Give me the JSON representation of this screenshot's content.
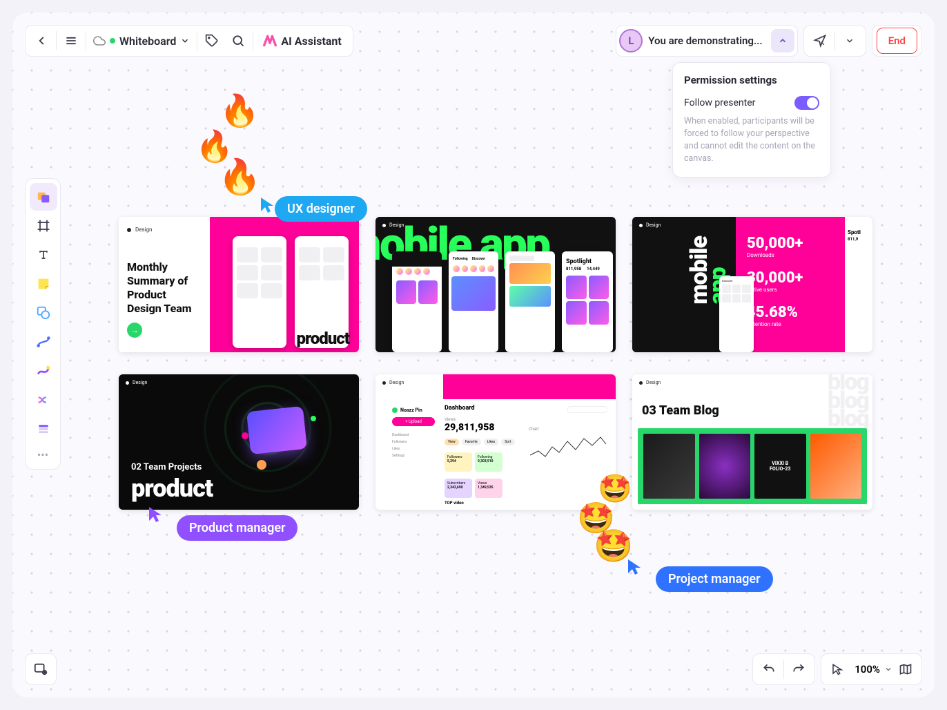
{
  "topbar": {
    "board_name": "Whiteboard",
    "ai_label": "AI Assistant"
  },
  "demo": {
    "avatar_initial": "L",
    "status_text": "You are demonstrating...",
    "end_label": "End"
  },
  "permissions": {
    "title": "Permission settings",
    "follow_label": "Follow presenter",
    "follow_enabled": true,
    "description": "When enabled, participants will be forced to follow your perspective and cannot edit the content on the canvas."
  },
  "cursors": {
    "ux": "UX designer",
    "product": "Product manager",
    "project": "Project manager"
  },
  "zoom": {
    "level": "100%"
  },
  "cards": {
    "c1": {
      "tag": "Design",
      "title": "Monthly Summary of Product Design Team",
      "footer_word": "product"
    },
    "c2": {
      "tag": "Design",
      "headline": "mobile app",
      "spotlight_title": "Spotlight",
      "num1": "811,958",
      "num2": "14,449",
      "tab_following": "Following",
      "tab_discover": "Discover"
    },
    "c3": {
      "tag": "Design",
      "mobile_word_a": "mobile",
      "mobile_word_b": "app",
      "stat1_num": "50,000+",
      "stat1_lbl": "Downloads",
      "stat2_num": "30,000+",
      "stat2_lbl": "Active users",
      "stat3_num": "45.68%",
      "stat3_lbl": "Retention rate",
      "spotlight": "Spotl",
      "spot_num": "811,9"
    },
    "c4": {
      "tag": "Design",
      "subtitle": "02 Team Projects",
      "title": "product"
    },
    "c5": {
      "tag": "Design",
      "sidebar_name": "Noazz Pin",
      "upload": "+ Upload",
      "nav1": "Dashboard",
      "nav2": "Followers",
      "nav3": "Likes",
      "nav4": "Settings",
      "dash_title": "Dashboard",
      "views_label": "Views",
      "views_num": "29,811,958",
      "chart_label": "Chart",
      "chip_view": "View",
      "chip_likes": "Likes",
      "stat1_lbl": "Followers",
      "stat1_num": "5,294",
      "stat2_lbl": "Following",
      "stat2_num": "9,303,910",
      "stat3_lbl": "Subscribers",
      "stat3_num": "2,343,690",
      "stat4_lbl": "Views",
      "stat4_num": "1,349,535",
      "top_video": "TOP video"
    },
    "c6": {
      "tag": "Design",
      "blog_word": "blog\nblog\nblog",
      "title": "03 Team Blog",
      "thumb3_t1": "VIXXI B",
      "thumb3_t2": "FOLIO-23"
    }
  }
}
